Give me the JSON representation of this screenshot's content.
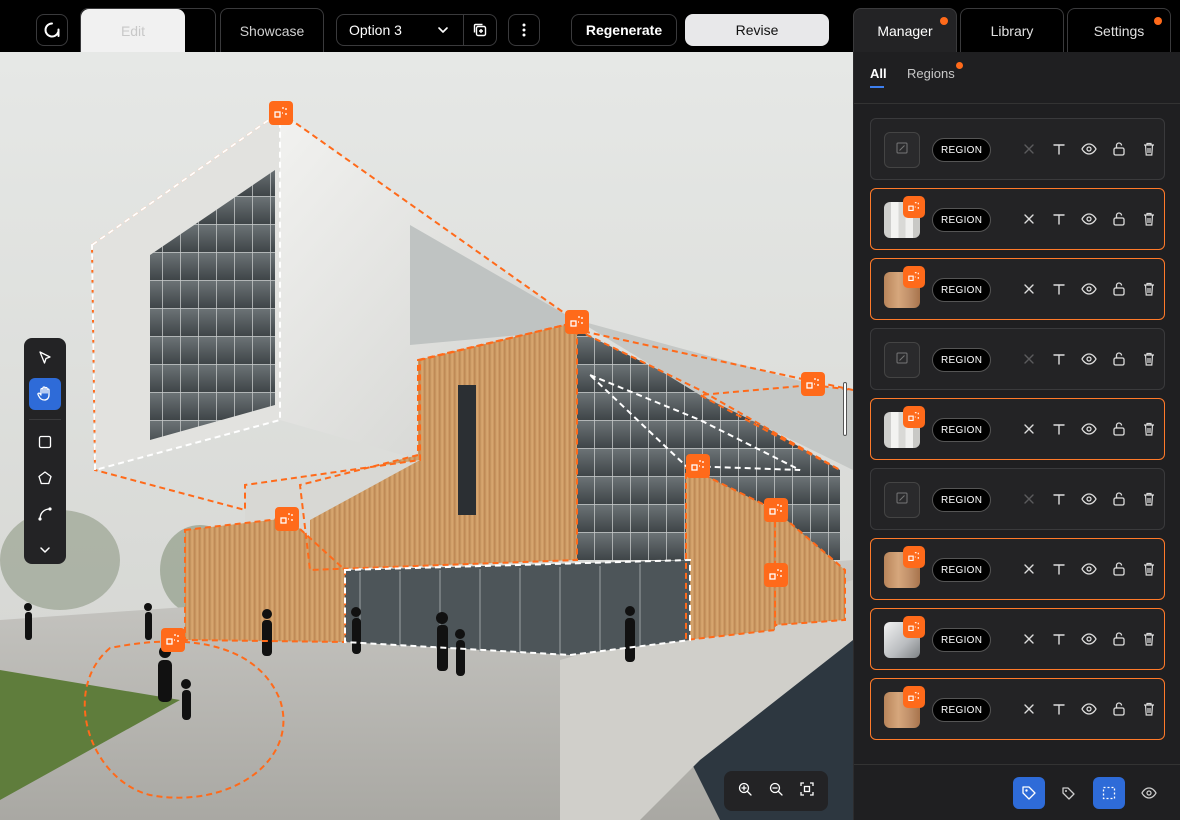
{
  "header": {
    "tabs": {
      "edit": "Edit",
      "showcase": "Showcase"
    },
    "option_select": {
      "value": "Option 3"
    },
    "regenerate_label": "Regenerate",
    "revise_label": "Revise"
  },
  "right_tabs": {
    "manager": "Manager",
    "library": "Library",
    "settings": "Settings"
  },
  "panel": {
    "subtabs": {
      "all": "All",
      "regions": "Regions"
    },
    "regions": [
      {
        "tag": "REGION",
        "thumb": "empty",
        "selected": false
      },
      {
        "tag": "REGION",
        "thumb": "white-panels",
        "selected": true
      },
      {
        "tag": "REGION",
        "thumb": "wood",
        "selected": true
      },
      {
        "tag": "REGION",
        "thumb": "empty",
        "selected": false
      },
      {
        "tag": "REGION",
        "thumb": "white-panels",
        "selected": true
      },
      {
        "tag": "REGION",
        "thumb": "empty",
        "selected": false
      },
      {
        "tag": "REGION",
        "thumb": "wood",
        "selected": true
      },
      {
        "tag": "REGION",
        "thumb": "glass",
        "selected": true
      },
      {
        "tag": "REGION",
        "thumb": "wood",
        "selected": true
      }
    ]
  },
  "colors": {
    "accent": "#ff6a1a",
    "primary": "#2e6bd8",
    "panel_bg": "#1f1f21"
  }
}
